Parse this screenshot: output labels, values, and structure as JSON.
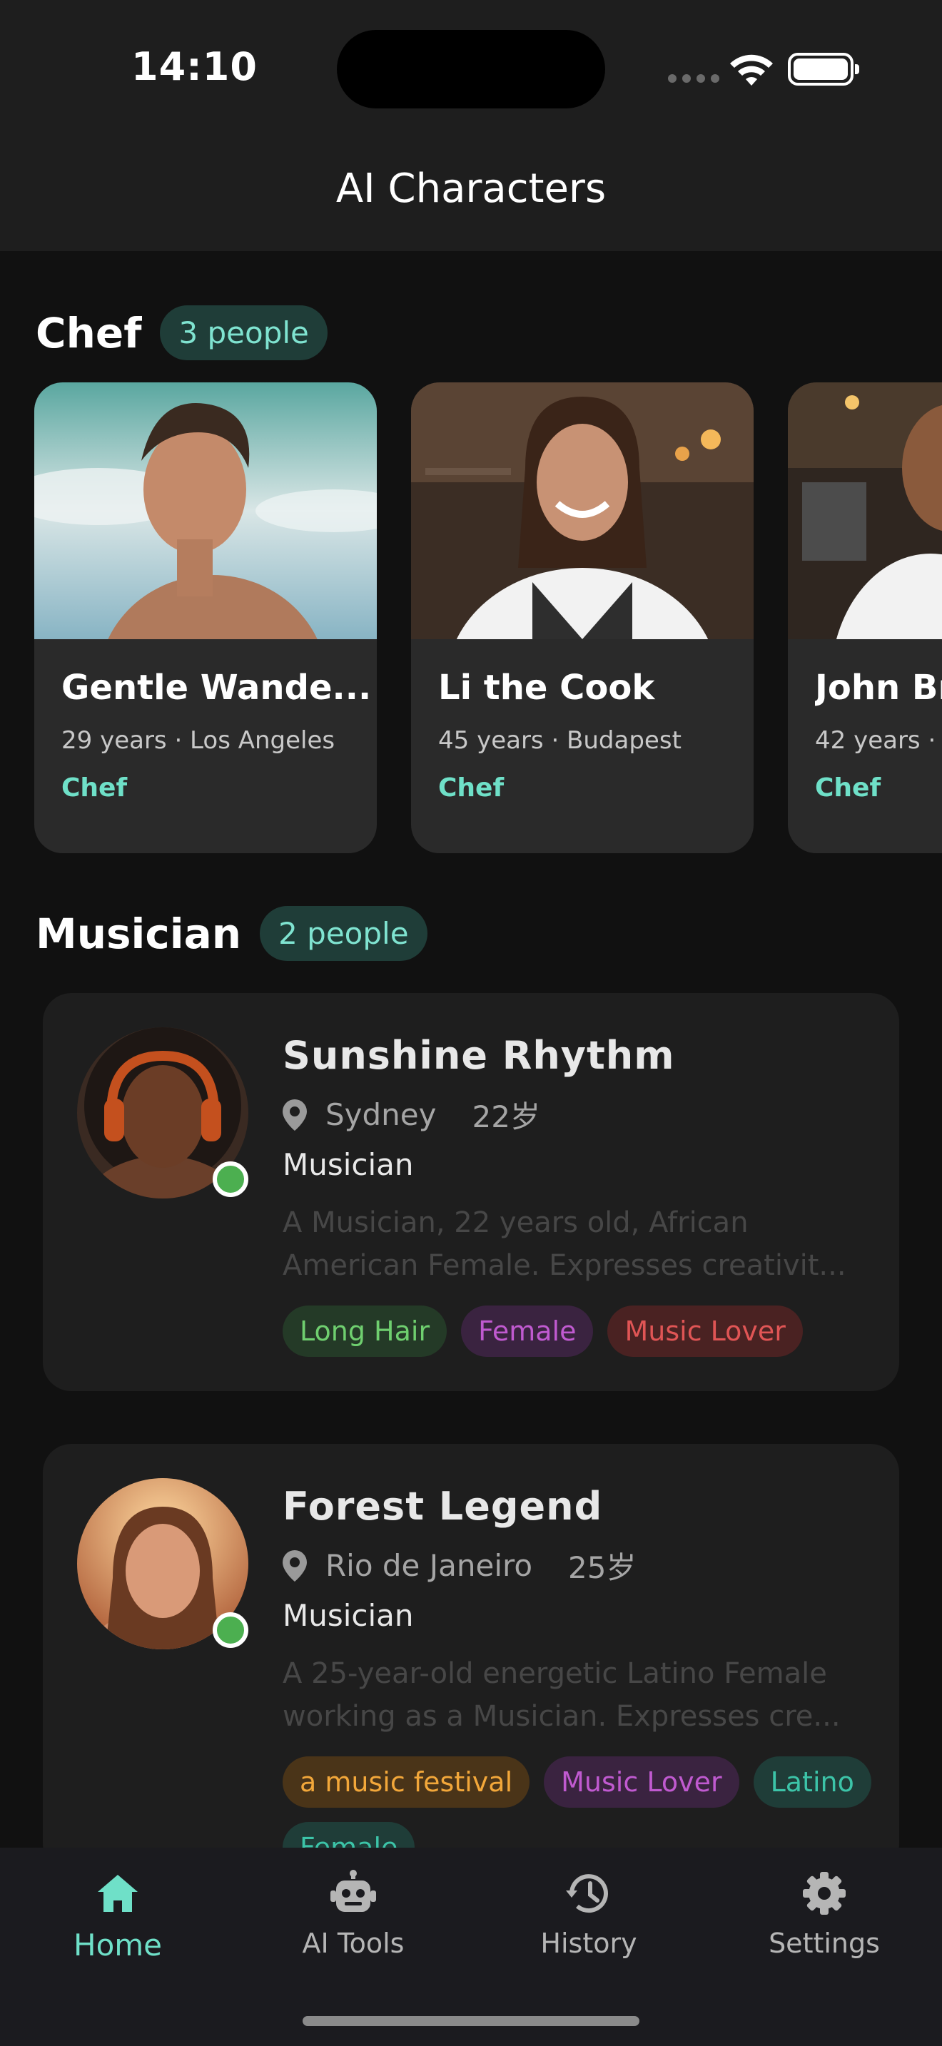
{
  "status_bar": {
    "time": "14:10"
  },
  "nav": {
    "title": "AI Characters"
  },
  "sections": [
    {
      "title": "Chef",
      "count": "3 people",
      "cards": [
        {
          "name": "Gentle Wande...",
          "meta": "29 years · Los Angeles",
          "role": "Chef"
        },
        {
          "name": "Li the Cook",
          "meta": "45 years · Budapest",
          "role": "Chef"
        },
        {
          "name": "John Br",
          "meta": "42 years ·",
          "role": "Chef"
        }
      ]
    },
    {
      "title": "Musician",
      "count": "2 people",
      "cards": [
        {
          "name": "Sunshine Rhythm",
          "location": "Sydney",
          "age": "22岁",
          "role": "Musician",
          "description": "A Musician, 22 years old, African American Female. Expresses creativit...",
          "tags": [
            {
              "label": "Long Hair",
              "bg": "#243a27",
              "fg": "#6fcf6f"
            },
            {
              "label": "Female",
              "bg": "#3a2340",
              "fg": "#c05ad0"
            },
            {
              "label": "Music Lover",
              "bg": "#4a2222",
              "fg": "#e05555"
            }
          ]
        },
        {
          "name": "Forest Legend",
          "location": "Rio de Janeiro",
          "age": "25岁",
          "role": "Musician",
          "description": "A 25-year-old energetic Latino Female working as a Musician. Expresses cre...",
          "tags": [
            {
              "label": "a music festival",
              "bg": "#4a3418",
              "fg": "#f2a73a"
            },
            {
              "label": "Music Lover",
              "bg": "#3a2340",
              "fg": "#c05ad0"
            },
            {
              "label": "Latino",
              "bg": "#1f3d38",
              "fg": "#3cc4a8"
            },
            {
              "label": "Female",
              "bg": "#1f3d38",
              "fg": "#3cc4a8"
            }
          ]
        }
      ]
    }
  ],
  "tabbar": {
    "items": [
      {
        "label": "Home",
        "icon": "home-icon",
        "active": true
      },
      {
        "label": "AI Tools",
        "icon": "robot-icon",
        "active": false
      },
      {
        "label": "History",
        "icon": "history-icon",
        "active": false
      },
      {
        "label": "Settings",
        "icon": "gear-icon",
        "active": false
      }
    ],
    "active_color": "#6fe0c8"
  }
}
